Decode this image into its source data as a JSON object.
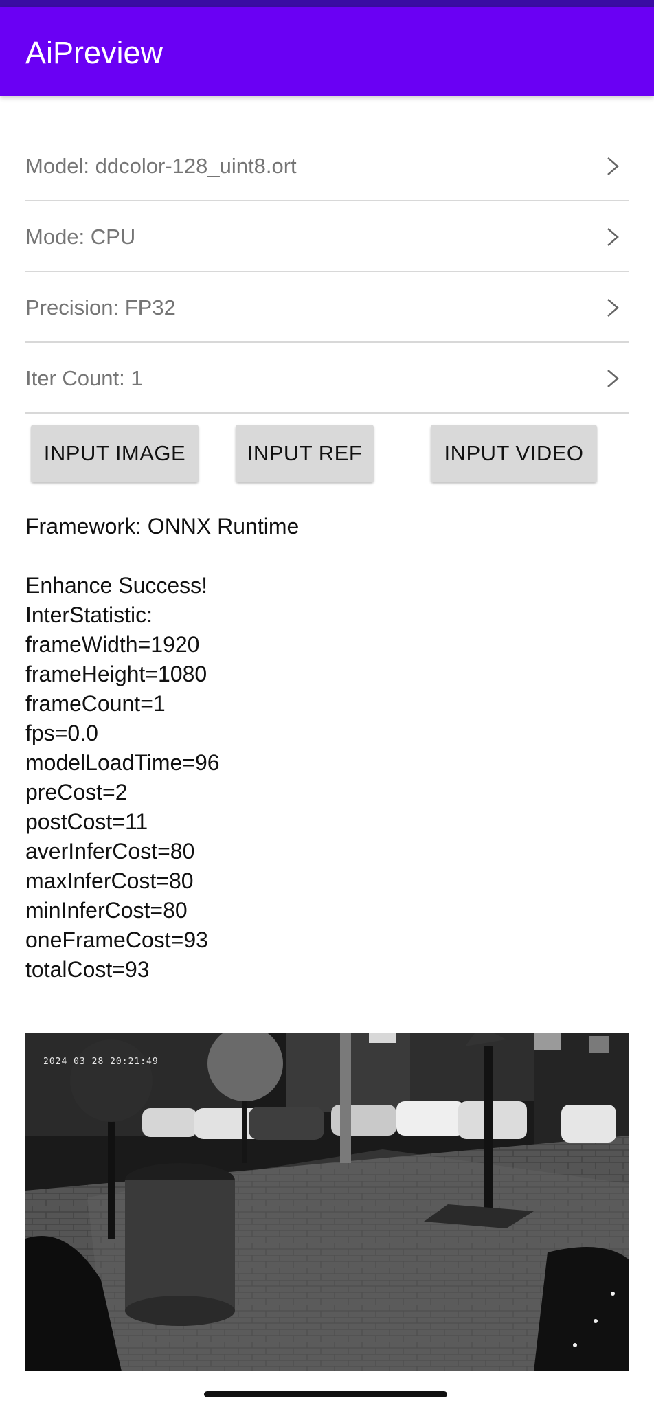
{
  "app": {
    "title": "AiPreview"
  },
  "settings": [
    {
      "label": "Model: ddcolor-128_uint8.ort"
    },
    {
      "label": "Mode: CPU"
    },
    {
      "label": "Precision: FP32"
    },
    {
      "label": "Iter Count: 1"
    }
  ],
  "buttons": {
    "input_image": "INPUT IMAGE",
    "input_ref": "INPUT REF",
    "input_video": "INPUT VIDEO"
  },
  "framework": "Framework: ONNX Runtime",
  "stats": [
    "Enhance Success!",
    "InterStatistic:",
    "frameWidth=1920",
    "frameHeight=1080",
    "frameCount=1",
    "fps=0.0",
    "modelLoadTime=96",
    "preCost=2",
    "postCost=11",
    "averInferCost=80",
    "maxInferCost=80",
    "minInferCost=80",
    "oneFrameCost=93",
    "totalCost=93"
  ],
  "preview": {
    "timestamp": "2024 03 28 20:21:49"
  },
  "colors": {
    "app_bar": "#6a00f4",
    "status_bar": "#3a0ca3"
  }
}
